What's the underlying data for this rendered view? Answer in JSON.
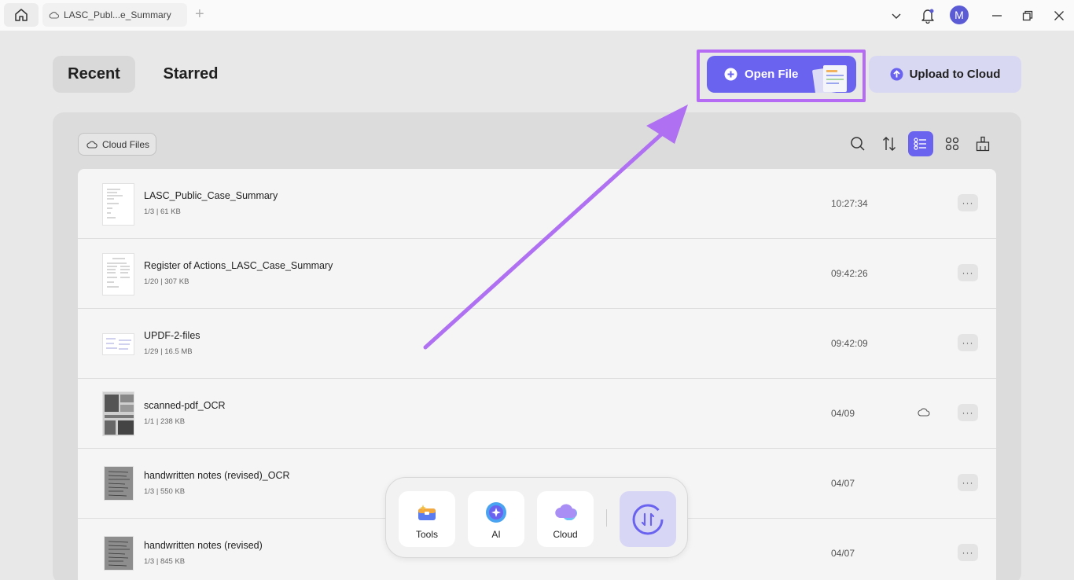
{
  "titlebar": {
    "tab_title": "LASC_Publ...e_Summary",
    "add_tab": "+",
    "avatar_initial": "M"
  },
  "header": {
    "recent_label": "Recent",
    "starred_label": "Starred",
    "open_file_label": "Open File",
    "upload_label": "Upload to Cloud"
  },
  "panel": {
    "cloud_files_label": "Cloud Files"
  },
  "files": [
    {
      "name": "LASC_Public_Case_Summary",
      "meta": "1/3 | 61 KB",
      "time": "10:27:34",
      "cloud": false
    },
    {
      "name": "Register of Actions_LASC_Case_Summary",
      "meta": "1/20 | 307 KB",
      "time": "09:42:26",
      "cloud": false
    },
    {
      "name": "UPDF-2-files",
      "meta": "1/29 | 16.5 MB",
      "time": "09:42:09",
      "cloud": false
    },
    {
      "name": "scanned-pdf_OCR",
      "meta": "1/1 | 238 KB",
      "time": "04/09",
      "cloud": true
    },
    {
      "name": "handwritten notes (revised)_OCR",
      "meta": "1/3 | 550 KB",
      "time": "04/07",
      "cloud": false
    },
    {
      "name": "handwritten notes (revised)",
      "meta": "1/3 | 845 KB",
      "time": "04/07",
      "cloud": false
    }
  ],
  "more_label": "···",
  "dock": {
    "tools_label": "Tools",
    "ai_label": "AI",
    "cloud_label": "Cloud"
  },
  "colors": {
    "accent": "#6a63f0",
    "highlight": "#b66bf5"
  }
}
